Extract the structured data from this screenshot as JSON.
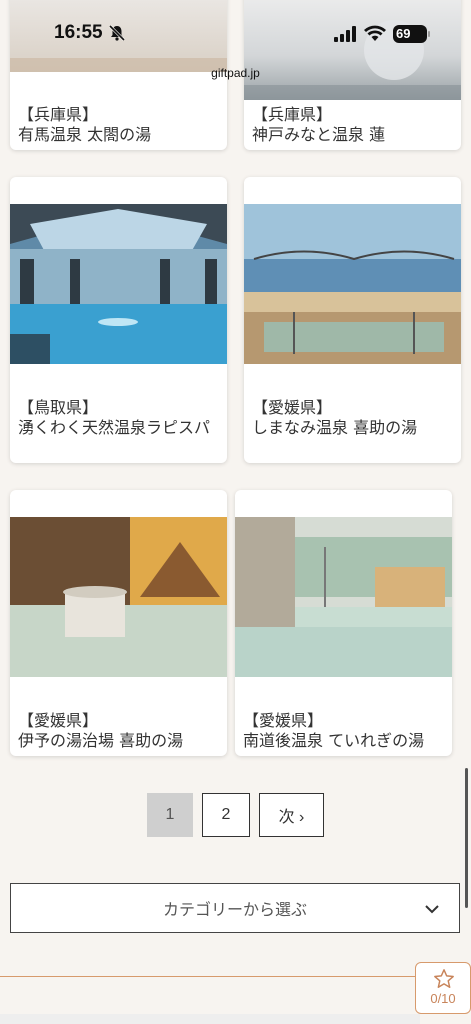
{
  "status_bar": {
    "time": "16:55",
    "battery": "69"
  },
  "browser": {
    "url": "giftpad.jp"
  },
  "cards": [
    {
      "prefecture": "【兵庫県】",
      "name": "有馬温泉 太閤の湯"
    },
    {
      "prefecture": "【兵庫県】",
      "name": "神戸みなと温泉 蓮"
    },
    {
      "prefecture": "【鳥取県】",
      "name": "湧くわく天然温泉ラピスパ"
    },
    {
      "prefecture": "【愛媛県】",
      "name": "しまなみ温泉 喜助の湯"
    },
    {
      "prefecture": "【愛媛県】",
      "name": "伊予の湯治場 喜助の湯"
    },
    {
      "prefecture": "【愛媛県】",
      "name": "南道後温泉 ていれぎの湯"
    }
  ],
  "pagination": {
    "current": "1",
    "page2": "2",
    "next": "次 ›"
  },
  "category_select": {
    "label": "カテゴリーから選ぶ"
  },
  "favorites": {
    "count": "0/10"
  },
  "colors": {
    "accent": "#d79a6c",
    "background": "#f7f4f0"
  }
}
